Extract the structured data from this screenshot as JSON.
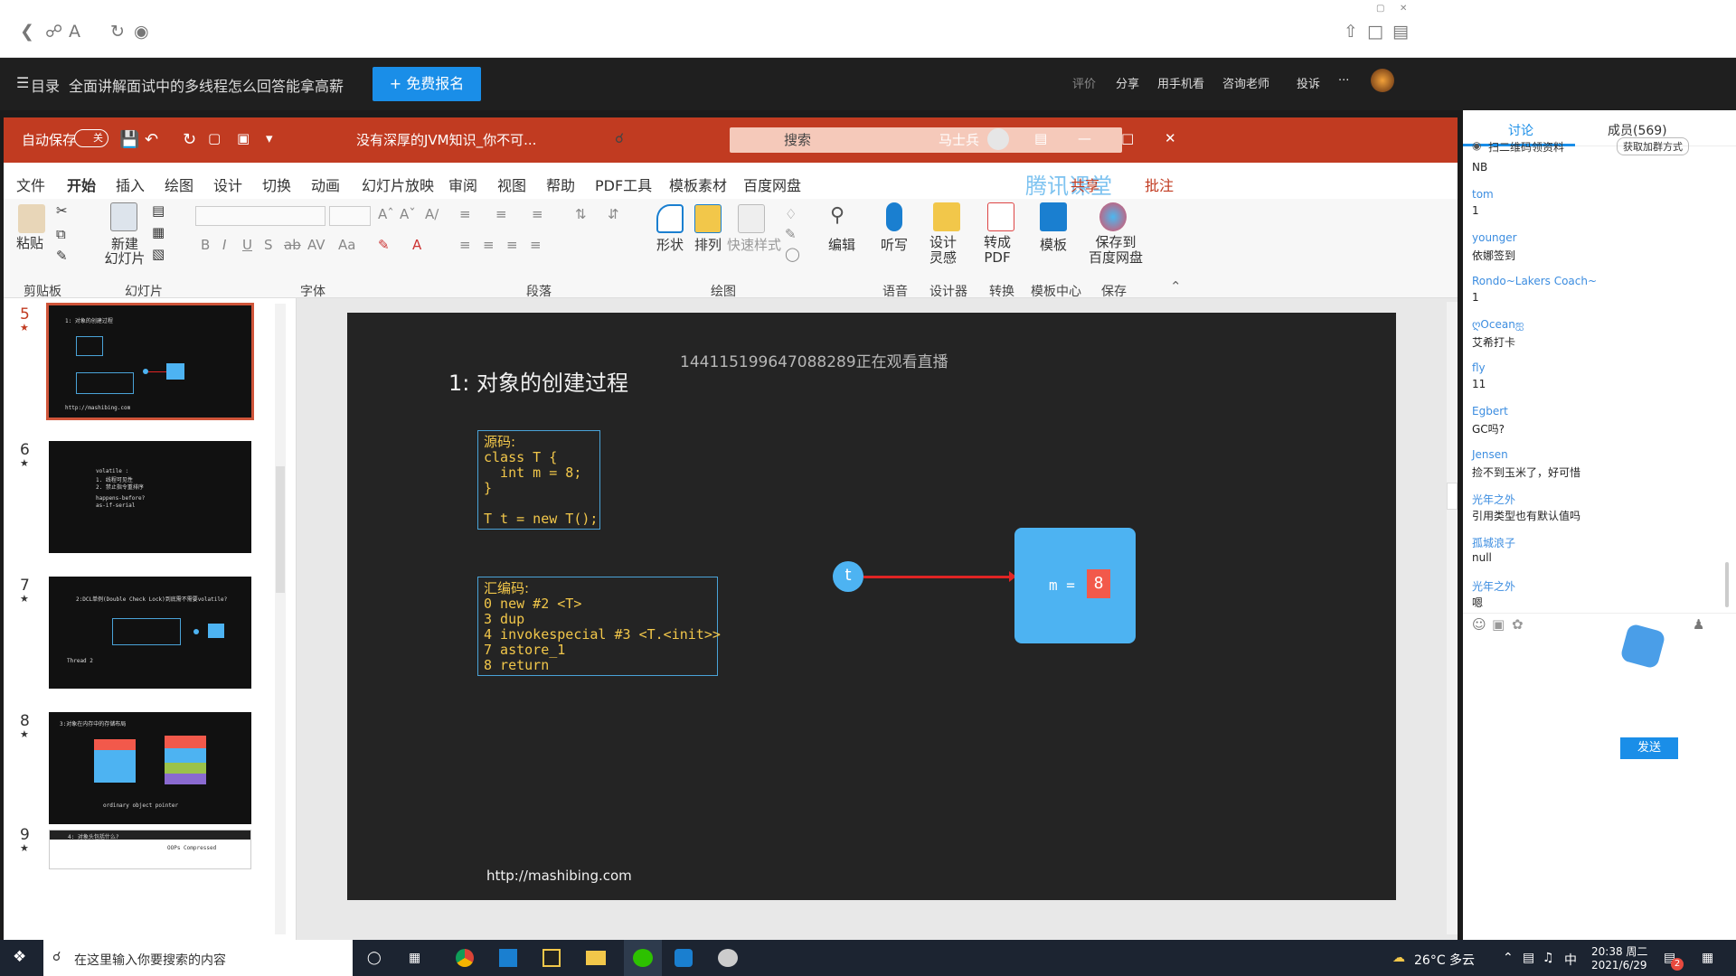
{
  "browser": {
    "icons": [
      "back-icon",
      "link-icon",
      "font-icon",
      "refresh-icon",
      "compass-icon",
      "share-icon",
      "box-icon",
      "clipboard-icon"
    ]
  },
  "course_header": {
    "menu_label": "目录",
    "title": "全面讲解面试中的多线程怎么回答能拿高薪",
    "signup_button": "+ 免费报名",
    "actions": [
      "评价",
      "分享",
      "用手机看",
      "咨询老师",
      "投诉",
      "···"
    ]
  },
  "ppt": {
    "autosave_label": "自动保存",
    "autosave_state": "关",
    "file_name": "没有深厚的JVM知识_你不可...",
    "search_placeholder": "搜索",
    "user_name": "马士兵",
    "share_label": "共享",
    "comment_label": "批注",
    "watermark": "腾讯课堂",
    "tabs": [
      "文件",
      "开始",
      "插入",
      "绘图",
      "设计",
      "切换",
      "动画",
      "幻灯片放映",
      "审阅",
      "视图",
      "帮助",
      "PDF工具",
      "模板素材",
      "百度网盘"
    ],
    "active_tab": "开始",
    "ribbon": {
      "paste": "粘贴",
      "new_slide": "新建\n幻灯片",
      "shape": "形状",
      "arrange": "排列",
      "quick_style": "快速样式",
      "edit": "编辑",
      "dictate": "听写",
      "design_ideas": "设计\n灵感",
      "to_pdf": "转成\nPDF",
      "template": "模板",
      "save_netdisk": "保存到\n百度网盘",
      "groups": [
        "剪贴板",
        "幻灯片",
        "字体",
        "段落",
        "绘图",
        "语音",
        "设计器",
        "转换",
        "模板中心",
        "保存"
      ]
    },
    "slides": [
      {
        "num": "5",
        "selected": true
      },
      {
        "num": "6",
        "selected": false
      },
      {
        "num": "7",
        "selected": false
      },
      {
        "num": "8",
        "selected": false
      },
      {
        "num": "9",
        "selected": false
      }
    ],
    "current_slide": {
      "viewer_overlay": "144115199647088289正在观看直播",
      "title": "1: 对象的创建过程",
      "source_label": "源码:",
      "source_lines": [
        "class T {",
        "  int m = 8;",
        "}",
        "",
        "T t = new T();"
      ],
      "asm_label": "汇编码:",
      "asm_lines": [
        "0 new #2 <T>",
        "3 dup",
        "4 invokespecial #3 <T.<init>>",
        "7 astore_1",
        "8 return"
      ],
      "ref_label": "t",
      "obj_field": "m =",
      "obj_value": "8",
      "url": "http://mashibing.com",
      "colors": {
        "object_box": "#4db3f2",
        "value_box": "#f2594b",
        "arrow": "#e02424",
        "code_border": "#4aa3d8"
      }
    }
  },
  "chat": {
    "tab_discussion": "讨论",
    "tab_members": "成员(569)",
    "qr_notice": "扫二维码领资料",
    "join_group": "获取加群方式",
    "messages": [
      {
        "name": "",
        "text": "NB"
      },
      {
        "name": "tom",
        "text": "1"
      },
      {
        "name": "younger",
        "text": "依娜签到"
      },
      {
        "name": "Rondo~Lakers Coach~",
        "text": "1"
      },
      {
        "name": "ღOceanஐ",
        "text": "艾希打卡"
      },
      {
        "name": "fly",
        "text": "11"
      },
      {
        "name": "Egbert",
        "text": "GC吗?"
      },
      {
        "name": "Jensen",
        "text": "捡不到玉米了，好可惜"
      },
      {
        "name": "光年之外",
        "text": "引用类型也有默认值吗"
      },
      {
        "name": "孤城浪子",
        "text": "null"
      },
      {
        "name": "光年之外",
        "text": "嗯"
      }
    ],
    "send_button": "发送"
  },
  "taskbar": {
    "search_placeholder": "在这里输入你要搜索的内容",
    "weather": "26°C 多云",
    "ime": "中",
    "time": "20:38 周二",
    "date": "2021/6/29",
    "notification_count": "2"
  }
}
